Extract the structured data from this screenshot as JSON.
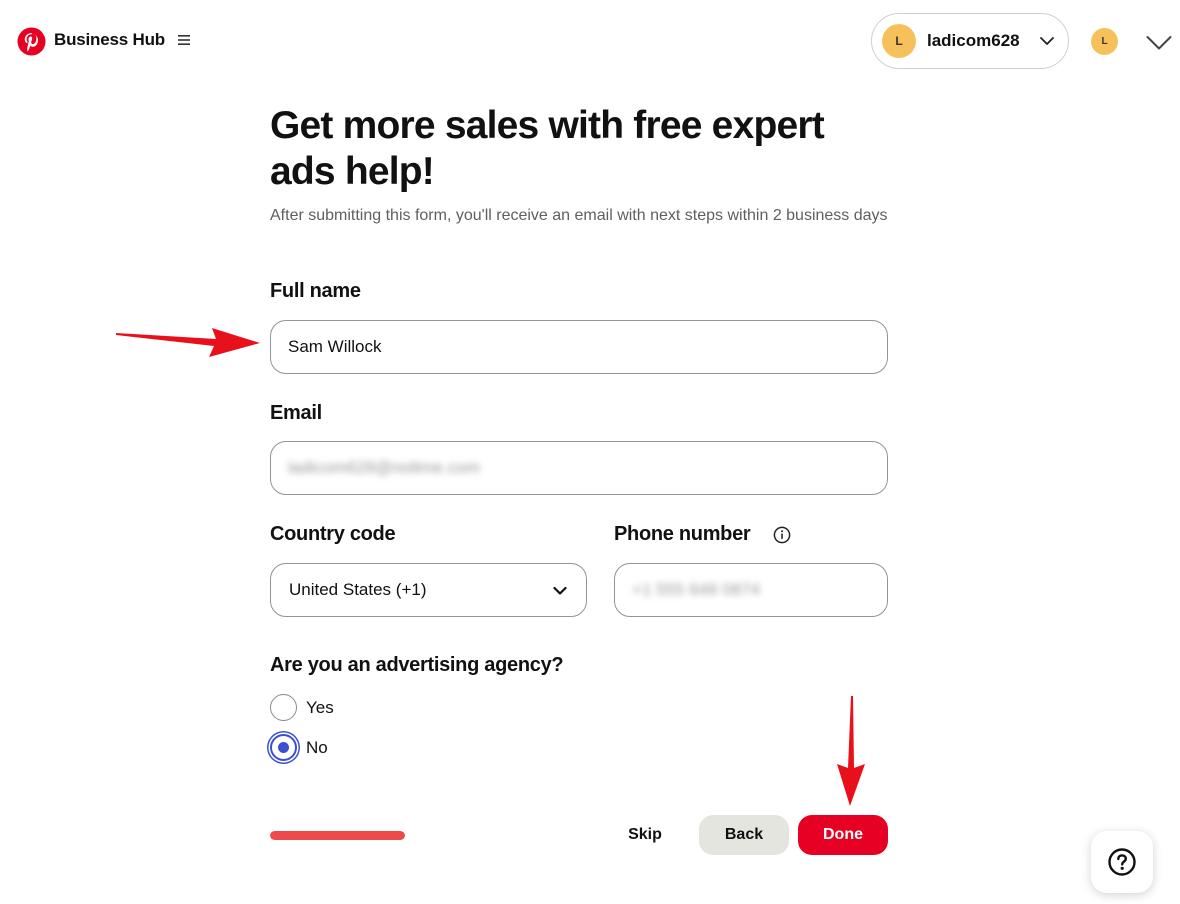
{
  "header": {
    "app_title": "Business Hub",
    "account_name": "ladicom628",
    "avatar_initial": "L"
  },
  "form": {
    "title": "Get more sales with free expert ads help!",
    "subtitle": "After submitting this form, you'll receive an email with next steps within 2 business days",
    "full_name_label": "Full name",
    "full_name_value": "Sam Willock",
    "email_label": "Email",
    "email_value": "ladicom628@noltme.com",
    "country_label": "Country code",
    "country_value": "United States (+1)",
    "phone_label": "Phone number",
    "phone_value": "+1 555 648 0874",
    "agency_question": "Are you an advertising agency?",
    "options": [
      {
        "label": "Yes",
        "checked": false
      },
      {
        "label": "No",
        "checked": true
      }
    ]
  },
  "footer": {
    "progress": 1.0,
    "skip_label": "Skip",
    "back_label": "Back",
    "done_label": "Done"
  },
  "colors": {
    "brand_red": "#e60023",
    "radio_blue": "#3b4fd0",
    "avatar_yellow": "#f6c15b",
    "annotation_arrow": "#e8101a"
  },
  "help": {
    "icon": "question-mark-icon"
  }
}
